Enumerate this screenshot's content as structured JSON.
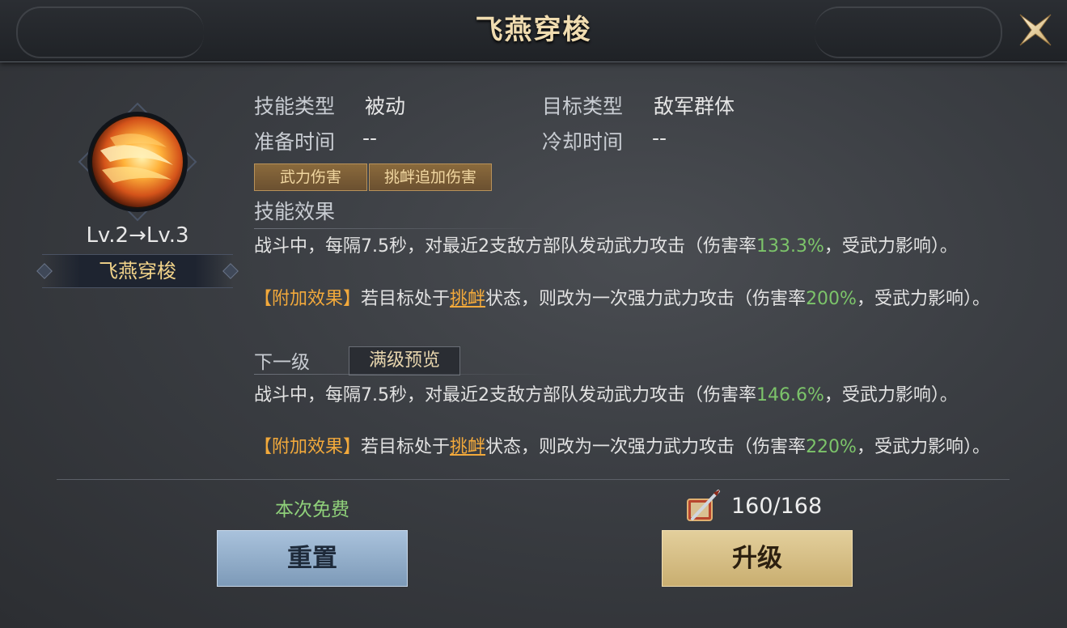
{
  "window": {
    "title": "飞燕穿梭"
  },
  "skill": {
    "level_text": "Lv.2→Lv.3",
    "name": "飞燕穿梭"
  },
  "info": {
    "skill_type_label": "技能类型",
    "skill_type_value": "被动",
    "target_type_label": "目标类型",
    "target_type_value": "敌军群体",
    "prep_time_label": "准备时间",
    "prep_time_value": "--",
    "cooldown_label": "冷却时间",
    "cooldown_value": "--"
  },
  "tags": [
    "武力伤害",
    "挑衅追加伤害"
  ],
  "effect": {
    "title": "技能效果",
    "line1_pre": "战斗中，每隔7.5秒，对最近2支敌方部队发动武力攻击（伤害率",
    "line1_val": "133.3%",
    "line1_post": "，受武力影响）。",
    "extra_label": "【附加效果】",
    "extra_pre": "若目标处于",
    "extra_status": "挑衅",
    "extra_mid": "状态，则改为一次强力武力攻击（伤害率",
    "extra_val": "200%",
    "extra_post": "，受武力影响）。"
  },
  "next": {
    "label": "下一级",
    "preview_button": "满级预览",
    "line1_pre": "战斗中，每隔7.5秒，对最近2支敌方部队发动武力攻击（伤害率",
    "line1_val": "146.6%",
    "line1_post": "，受武力影响）。",
    "extra_label": "【附加效果】",
    "extra_pre": "若目标处于",
    "extra_status": "挑衅",
    "extra_mid": "状态，则改为一次强力武力攻击（伤害率",
    "extra_val": "220%",
    "extra_post": "，受武力影响）。"
  },
  "footer": {
    "free_text": "本次免费",
    "reset_button": "重置",
    "upgrade_button": "升级",
    "cost_text": "160/168"
  }
}
